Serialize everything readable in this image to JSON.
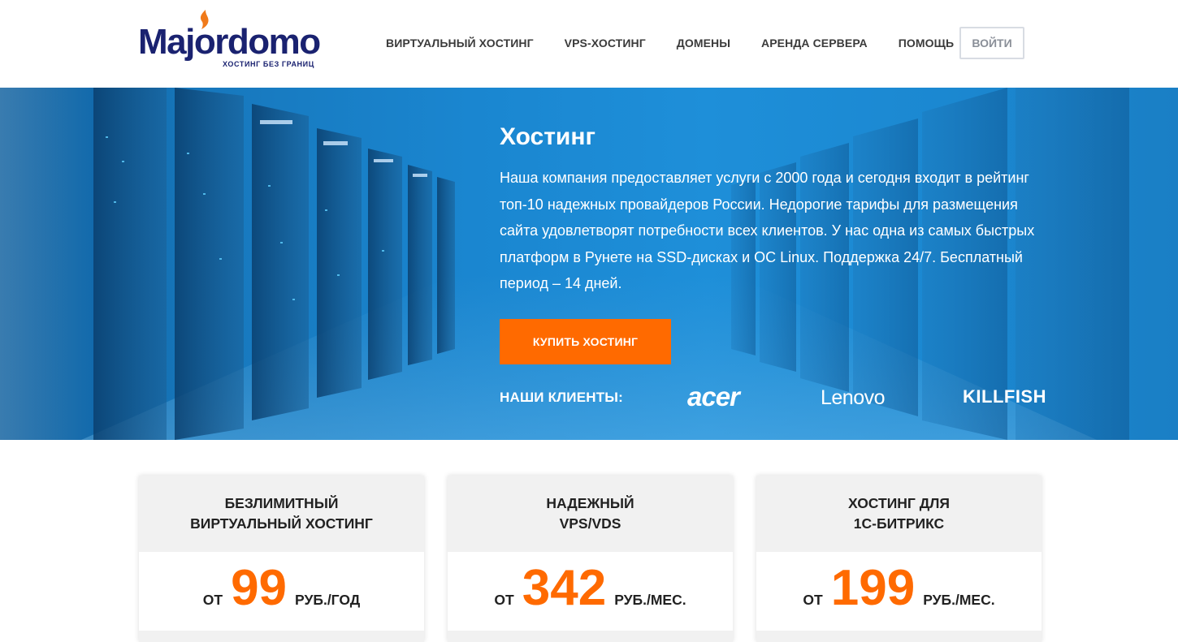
{
  "brand": {
    "name": "Majordomo",
    "tagline": "ХОСТИНГ БЕЗ ГРАНИЦ",
    "flame_color": "#f07a1a",
    "primary_color": "#1a2270"
  },
  "nav": {
    "items": [
      {
        "label": "ВИРТУАЛЬНЫЙ ХОСТИНГ"
      },
      {
        "label": "VPS-ХОСТИНГ"
      },
      {
        "label": "ДОМЕНЫ"
      },
      {
        "label": "АРЕНДА СЕРВЕРА"
      },
      {
        "label": "ПОМОЩЬ"
      }
    ],
    "login_label": "ВОЙТИ"
  },
  "hero": {
    "title": "Хостинг",
    "text": "Наша компания предоставляет услуги с 2000 года и сегодня входит в рейтинг топ-10 надежных провайдеров России. Недорогие тарифы для размещения сайта удовлетворят потребности всех клиентов. У нас одна из самых быстрых платформ в Рунете на SSD-дисках и ОС Linux. Поддержка 24/7. Бесплатный период – 14 дней.",
    "buy_label": "КУПИТЬ ХОСТИНГ",
    "clients_label": "НАШИ КЛИЕНТЫ:",
    "clients": [
      "acer",
      "Lenovo",
      "KILLFISH"
    ],
    "accent_color": "#ff6a00",
    "background_color": "#1a86d0"
  },
  "plans": [
    {
      "title_line1": "БЕЗЛИМИТНЫЙ",
      "title_line2": "ВИРТУАЛЬНЫЙ ХОСТИНГ",
      "prefix": "ОТ",
      "price": "99",
      "suffix": "РУБ./ГОД"
    },
    {
      "title_line1": "НАДЕЖНЫЙ",
      "title_line2": "VPS/VDS",
      "prefix": "ОТ",
      "price": "342",
      "suffix": "РУБ./МЕС."
    },
    {
      "title_line1": "ХОСТИНГ ДЛЯ",
      "title_line2": "1С-БИТРИКС",
      "prefix": "ОТ",
      "price": "199",
      "suffix": "РУБ./МЕС."
    }
  ]
}
